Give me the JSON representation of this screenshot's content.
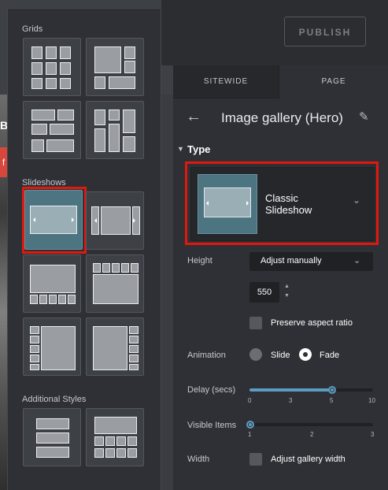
{
  "preview": {
    "letter": "B",
    "badge": "f"
  },
  "topbar": {
    "publish_label": "PUBLISH"
  },
  "tabs": [
    {
      "label": "SITEWIDE"
    },
    {
      "label": "PAGE"
    }
  ],
  "panel": {
    "title": "Image gallery (Hero)",
    "back_icon": "arrow-left-icon",
    "edit_icon": "pencil-icon",
    "type_section": "Type",
    "type_value": "Classic Slideshow",
    "height_label": "Height",
    "height_mode": "Adjust manually",
    "height_value": "550",
    "aspect_label": "Preserve aspect ratio",
    "aspect_checked": false,
    "animation_label": "Animation",
    "animation_options": [
      "Slide",
      "Fade"
    ],
    "animation_selected": "Fade",
    "delay_label": "Delay (secs)",
    "delay_ticks": [
      "0",
      "3",
      "5",
      "10"
    ],
    "delay_value": 5,
    "visible_label": "Visible Items",
    "visible_ticks": [
      "1",
      "2",
      "3"
    ],
    "visible_value": 1,
    "width_label": "Width",
    "width_option": "Adjust gallery width",
    "width_checked": false
  },
  "layout_popup": {
    "sections": [
      "Grids",
      "Slideshows",
      "Additional Styles"
    ],
    "selected_layout": "Classic Slideshow"
  },
  "colors": {
    "accent": "#5b9dc0",
    "highlight": "#e0180e",
    "selected_tile": "#4c7481"
  }
}
